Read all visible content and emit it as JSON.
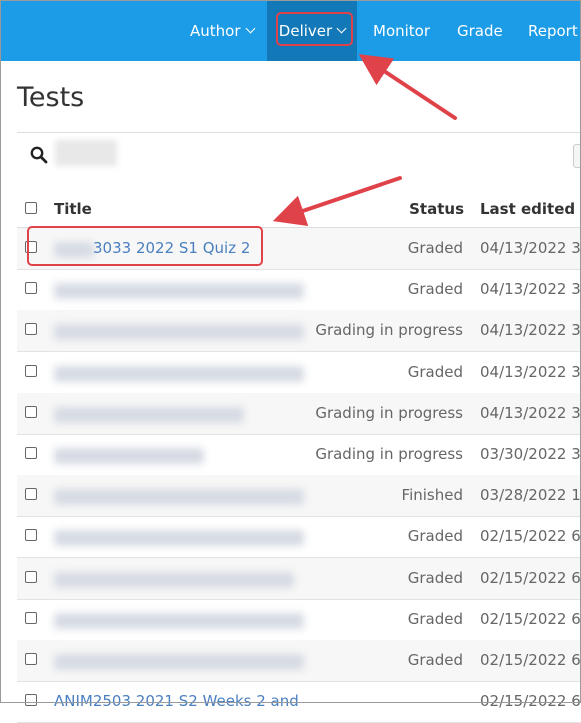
{
  "nav": {
    "items": [
      {
        "label": "Author",
        "has_dropdown": true
      },
      {
        "label": "Deliver",
        "has_dropdown": true,
        "active": true
      },
      {
        "label": "Monitor",
        "has_dropdown": false
      },
      {
        "label": "Grade",
        "has_dropdown": false
      },
      {
        "label": "Report",
        "has_dropdown": false
      }
    ]
  },
  "page": {
    "title": "Tests"
  },
  "search": {
    "icon": "search-icon"
  },
  "table": {
    "headers": {
      "title": "Title",
      "status": "Status",
      "last_edited": "Last edited"
    },
    "rows": [
      {
        "title": "3033 2022 S1 Quiz 2",
        "status": "Graded",
        "last_edited": "04/13/2022 3:"
      },
      {
        "title": "",
        "status": "Graded",
        "last_edited": "04/13/2022 3:"
      },
      {
        "title": "",
        "status": "Grading in progress",
        "last_edited": "04/13/2022 3:"
      },
      {
        "title": "",
        "status": "Graded",
        "last_edited": "04/13/2022 3:"
      },
      {
        "title": "",
        "status": "Grading in progress",
        "last_edited": "04/13/2022 3:"
      },
      {
        "title": "",
        "status": "Grading in progress",
        "last_edited": "03/30/2022 3:"
      },
      {
        "title": "",
        "status": "Finished",
        "last_edited": "03/28/2022 1("
      },
      {
        "title": "",
        "status": "Graded",
        "last_edited": "02/15/2022 6:"
      },
      {
        "title": "",
        "status": "Graded",
        "last_edited": "02/15/2022 6:"
      },
      {
        "title": "",
        "status": "Graded",
        "last_edited": "02/15/2022 6:"
      },
      {
        "title": "",
        "status": "Graded",
        "last_edited": "02/15/2022 6:"
      },
      {
        "title": "ANIM2503 2021 S2 Weeks 2 and",
        "status": "",
        "last_edited": "02/15/2022 6:"
      }
    ]
  },
  "colors": {
    "topbar": "#1c9be6",
    "active_nav": "#1378b8",
    "annotation": "#e0424a",
    "link": "#4a7fc0"
  }
}
